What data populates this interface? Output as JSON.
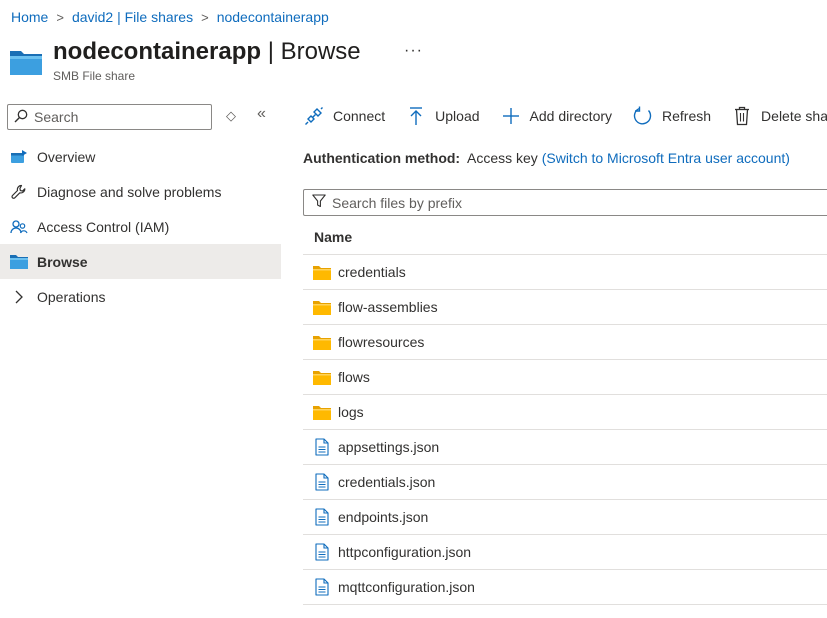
{
  "breadcrumb": {
    "items": [
      "Home",
      "david2 | File shares",
      "nodecontainerapp"
    ],
    "separator": ">"
  },
  "header": {
    "title_main": "nodecontainerapp",
    "title_sep": " | ",
    "title_section": "Browse",
    "subtitle": "SMB File share",
    "more_label": "···"
  },
  "sidebar": {
    "search_placeholder": "Search",
    "collapse_label": "«",
    "sort_label": "◇",
    "items": [
      {
        "label": "Overview",
        "icon": "overview-icon"
      },
      {
        "label": "Diagnose and solve problems",
        "icon": "wrench-icon"
      },
      {
        "label": "Access Control (IAM)",
        "icon": "people-icon"
      },
      {
        "label": "Browse",
        "icon": "folder-icon",
        "active": true
      },
      {
        "label": "Operations",
        "icon": "chevron-right-icon"
      }
    ]
  },
  "toolbar": {
    "connect": "Connect",
    "upload": "Upload",
    "add_directory": "Add directory",
    "refresh": "Refresh",
    "delete_share": "Delete share"
  },
  "auth": {
    "label": "Authentication method:",
    "value": "Access key",
    "link": "(Switch to Microsoft Entra user account)"
  },
  "filter": {
    "placeholder": "Search files by prefix"
  },
  "table": {
    "column_name": "Name",
    "rows": [
      {
        "name": "credentials",
        "type": "folder"
      },
      {
        "name": "flow-assemblies",
        "type": "folder"
      },
      {
        "name": "flowresources",
        "type": "folder"
      },
      {
        "name": "flows",
        "type": "folder"
      },
      {
        "name": "logs",
        "type": "folder"
      },
      {
        "name": "appsettings.json",
        "type": "file"
      },
      {
        "name": "credentials.json",
        "type": "file"
      },
      {
        "name": "endpoints.json",
        "type": "file"
      },
      {
        "name": "httpconfiguration.json",
        "type": "file"
      },
      {
        "name": "mqttconfiguration.json",
        "type": "file"
      }
    ]
  },
  "colors": {
    "link": "#0f6cbd",
    "folder": "#ffb900",
    "file_icon": "#0f6cbd",
    "active_nav_bg": "#edebe9"
  }
}
